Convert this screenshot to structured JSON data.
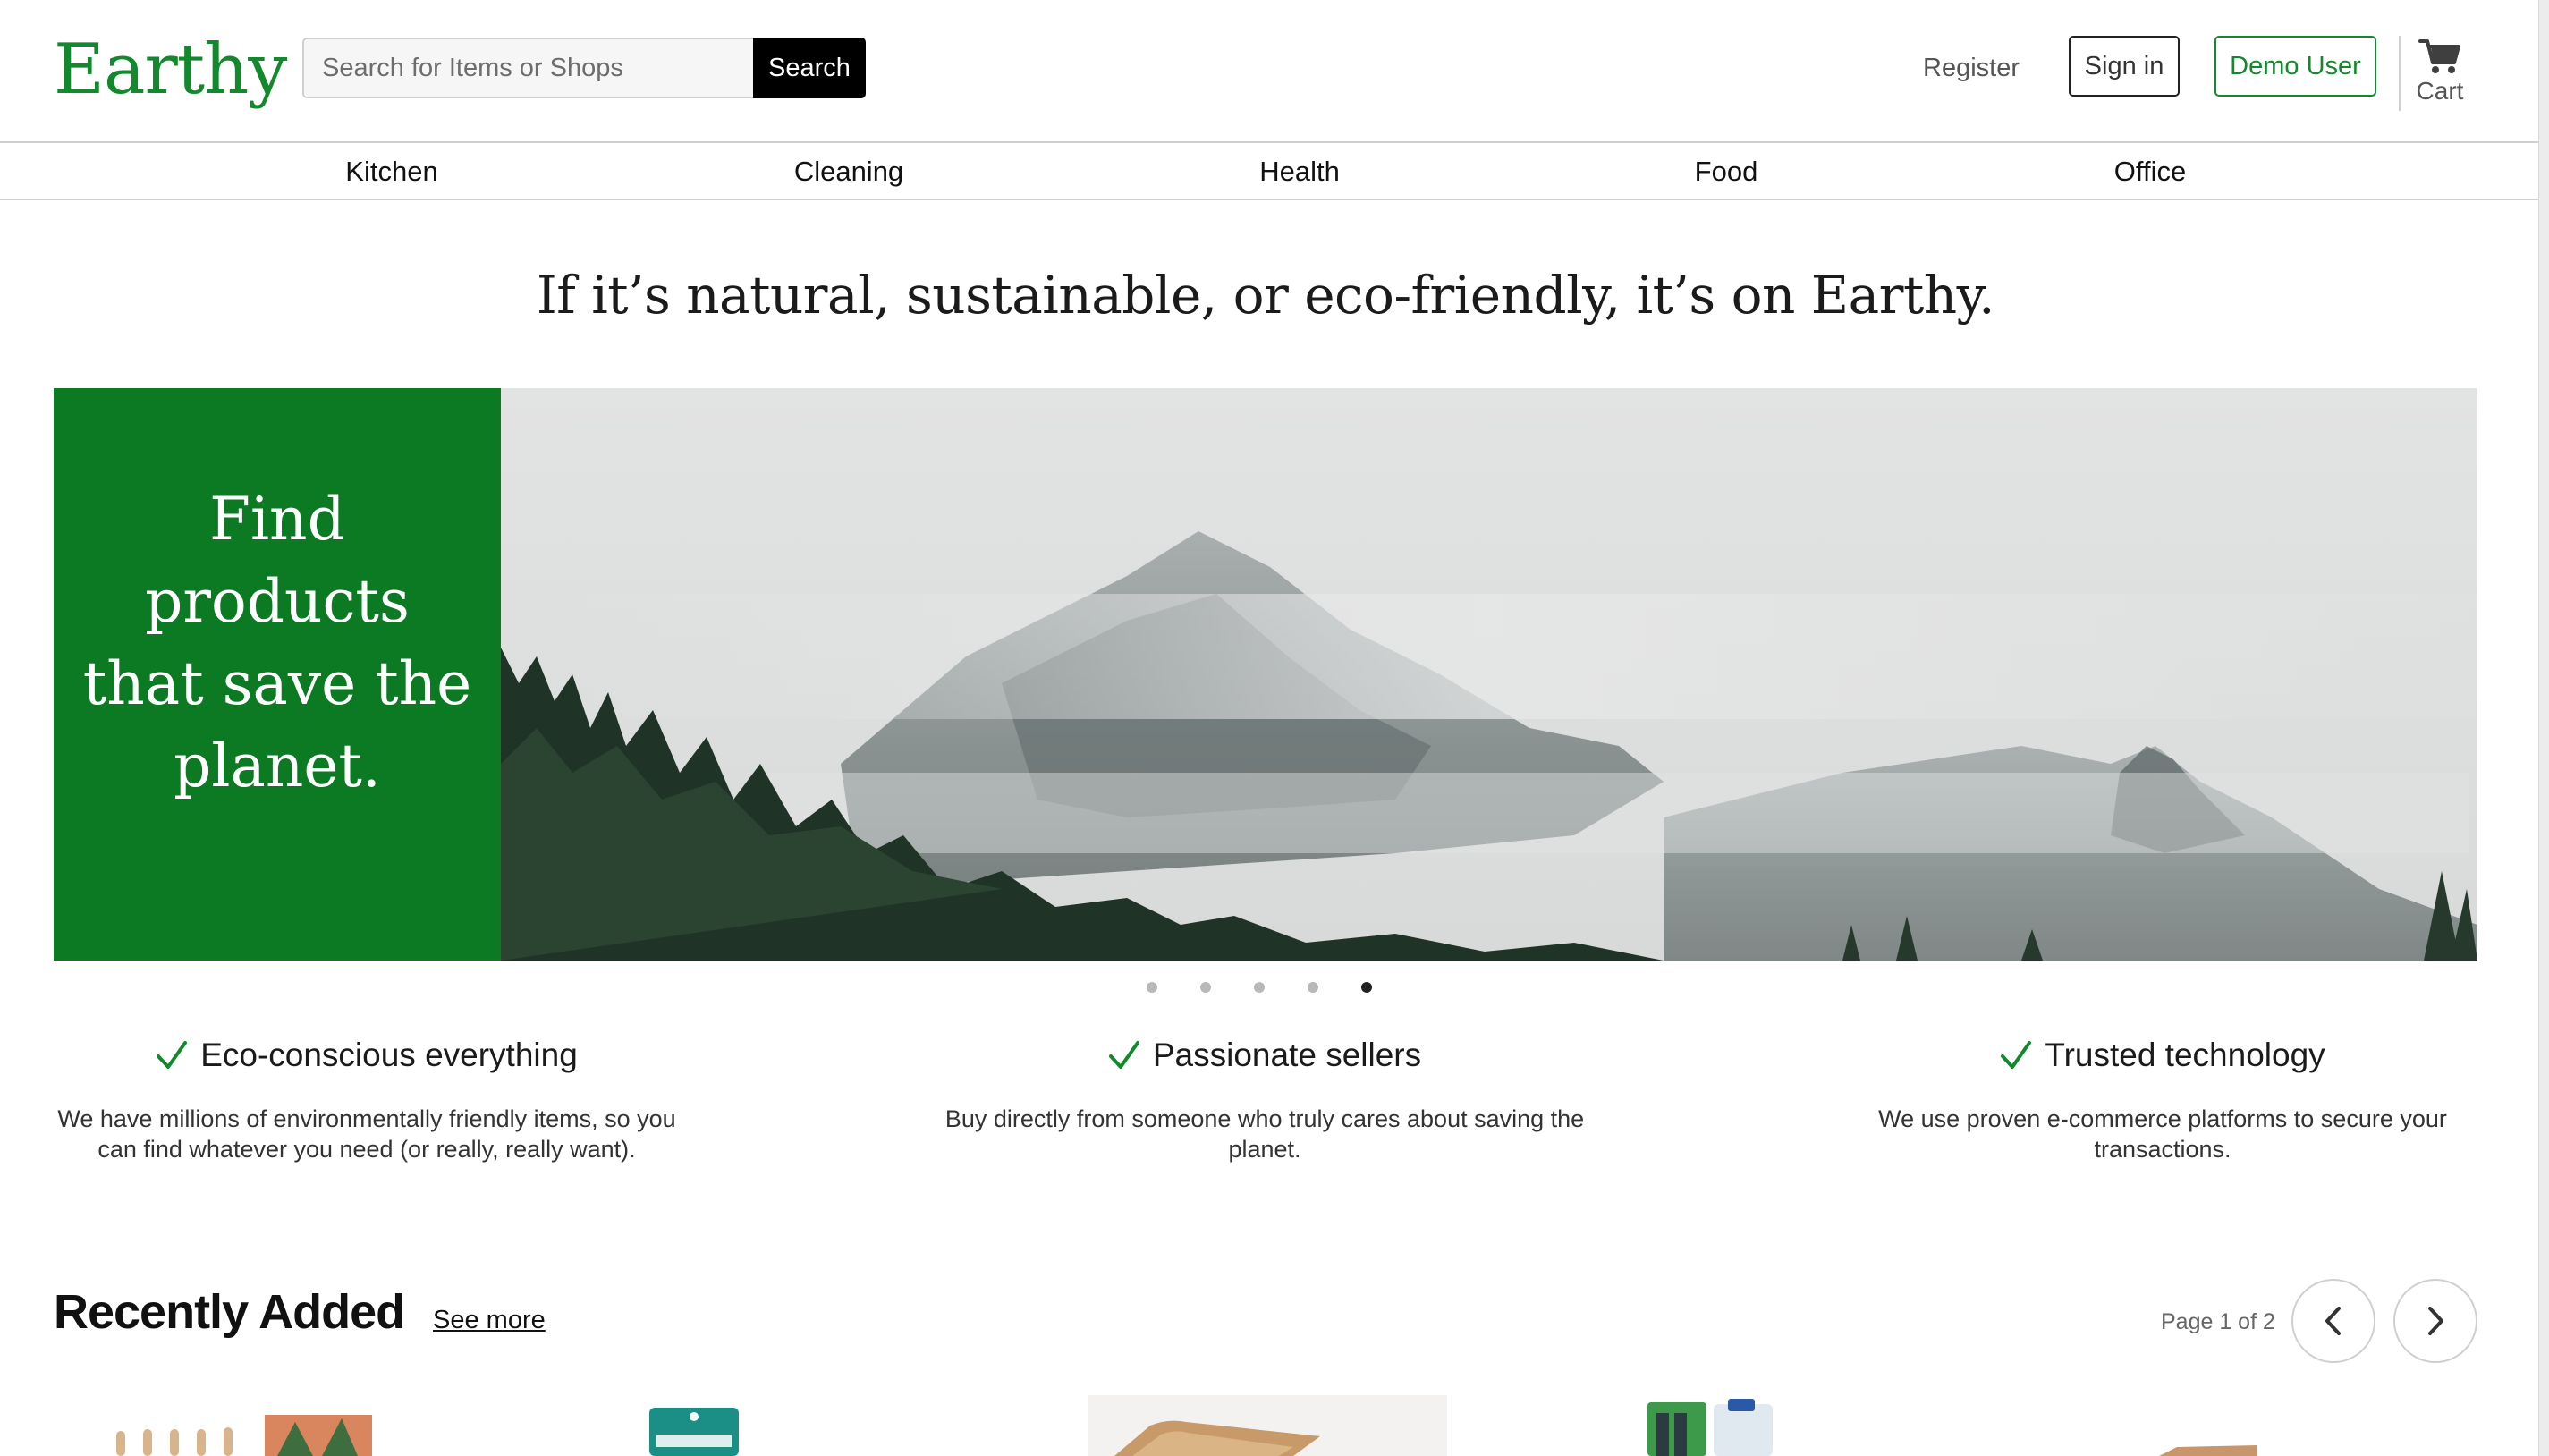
{
  "header": {
    "logo": "Earthy",
    "search_placeholder": "Search for Items or Shops",
    "search_button": "Search",
    "register": "Register",
    "sign_in": "Sign in",
    "demo_user": "Demo User",
    "cart": "Cart",
    "cart_icon": "cart-icon"
  },
  "nav": {
    "items": [
      {
        "label": "Kitchen"
      },
      {
        "label": "Cleaning"
      },
      {
        "label": "Health"
      },
      {
        "label": "Food"
      },
      {
        "label": "Office"
      }
    ]
  },
  "tagline": "If it’s natural, sustainable, or eco-friendly, it’s on Earthy.",
  "hero": {
    "text": "Find products that save the planet.",
    "slide_count": 5,
    "active_slide": 5
  },
  "features": [
    {
      "title": "Eco-conscious everything",
      "description": "We have millions of environmentally friendly items, so you can find whatever you need (or really, really want).",
      "icon": "check-icon"
    },
    {
      "title": "Passionate sellers",
      "description": "Buy directly from someone who truly cares about saving the planet.",
      "icon": "check-icon"
    },
    {
      "title": "Trusted technology",
      "description": "We use proven e-commerce platforms to secure your transactions.",
      "icon": "check-icon"
    }
  ],
  "recently_added": {
    "title": "Recently Added",
    "see_more": "See more",
    "page_text": "Page 1 of 2",
    "prev_icon": "chevron-left-icon",
    "next_icon": "chevron-right-icon"
  },
  "colors": {
    "brand_green": "#12892c",
    "hero_panel": "#0b7a23",
    "button_dark": "#000000"
  }
}
